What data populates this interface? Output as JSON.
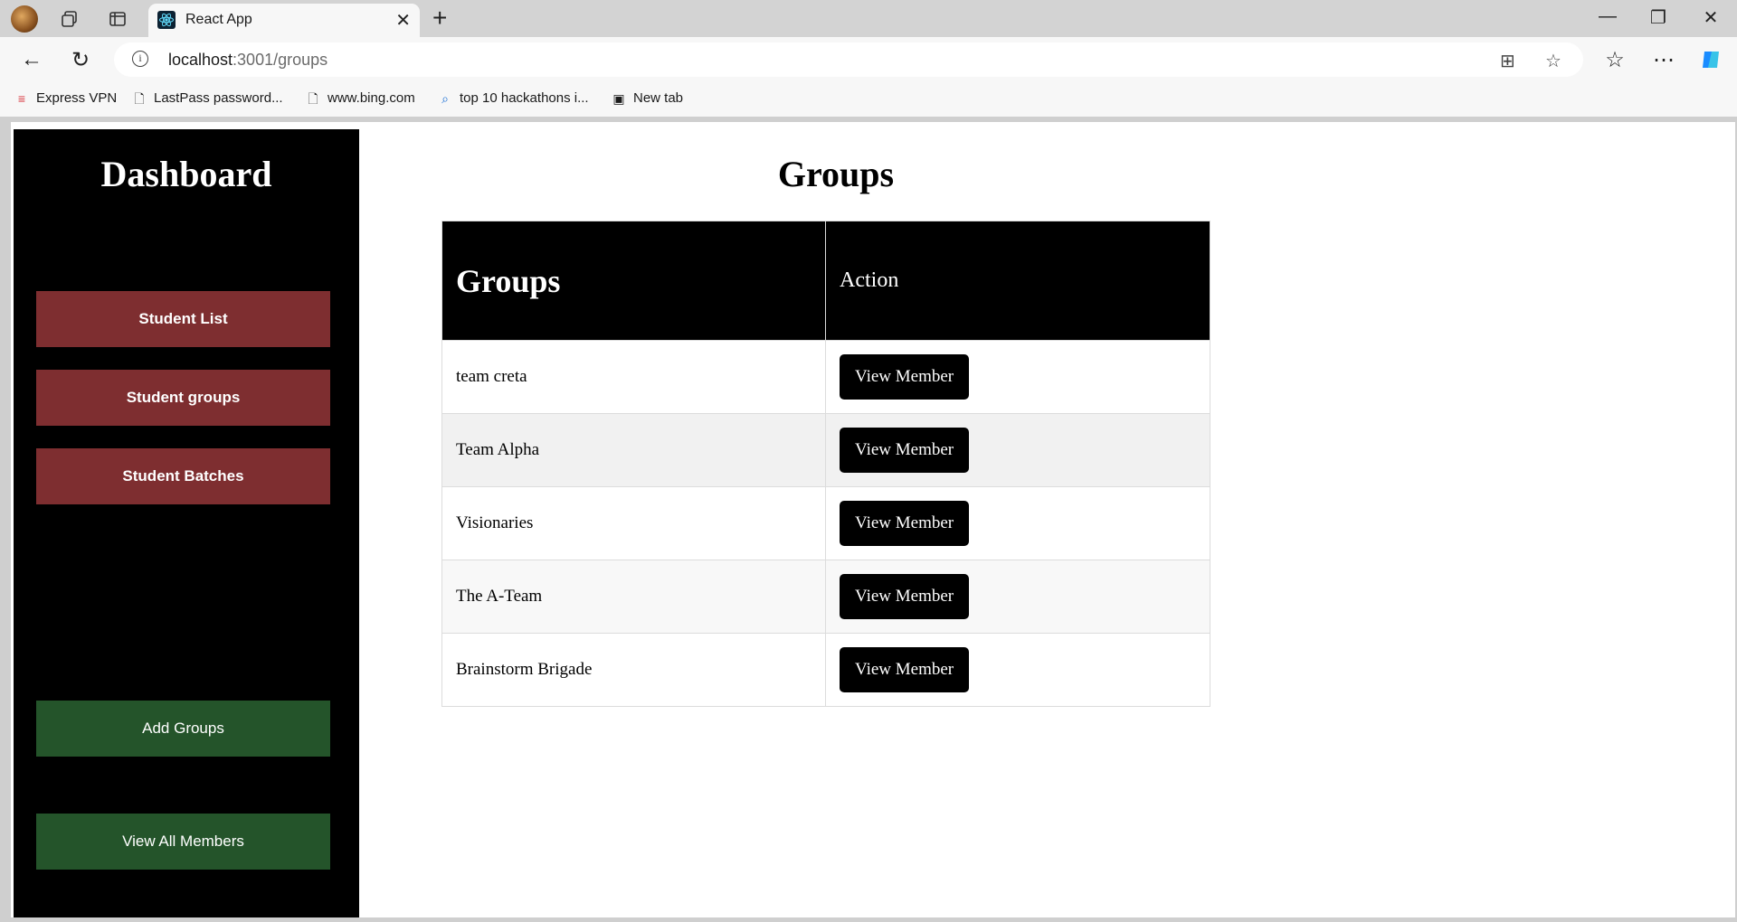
{
  "browser": {
    "tab_title": "React App",
    "url_host": "localhost",
    "url_path": ":3001/groups",
    "bookmarks": [
      {
        "label": "Express VPN",
        "icon": "expressvpn-icon"
      },
      {
        "label": "LastPass password...",
        "icon": "document-icon"
      },
      {
        "label": "www.bing.com",
        "icon": "document-icon"
      },
      {
        "label": "top 10 hackathons i...",
        "icon": "search-icon"
      },
      {
        "label": "New tab",
        "icon": "new-tab-icon"
      }
    ]
  },
  "sidebar": {
    "title": "Dashboard",
    "nav": [
      "Student List",
      "Student groups",
      "Student Batches"
    ],
    "actions": [
      "Add Groups",
      "View All Members"
    ],
    "colors": {
      "nav_bg": "#7e2e30",
      "action_bg": "#24542a"
    }
  },
  "main": {
    "title": "Groups",
    "table": {
      "headers": [
        "Groups",
        "Action"
      ],
      "rows": [
        {
          "name": "team creta",
          "action": "View Member"
        },
        {
          "name": "Team Alpha",
          "action": "View Member"
        },
        {
          "name": "Visionaries",
          "action": "View Member"
        },
        {
          "name": "The A-Team",
          "action": "View Member"
        },
        {
          "name": "Brainstorm Brigade",
          "action": "View Member"
        }
      ]
    }
  }
}
